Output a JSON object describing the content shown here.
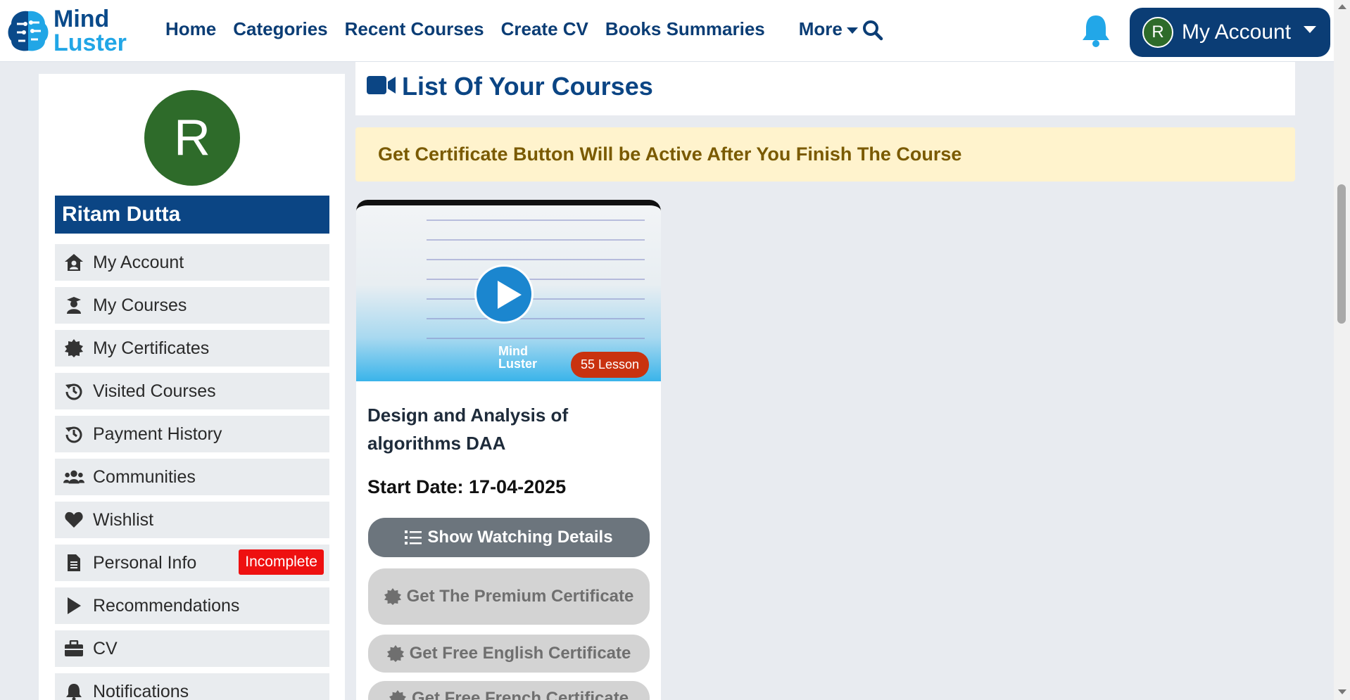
{
  "logo": {
    "line1": "Mind",
    "line2": "Luster"
  },
  "nav": {
    "items": [
      "Home",
      "Categories",
      "Recent Courses",
      "Create CV",
      "Books Summaries"
    ],
    "more": "More"
  },
  "account": {
    "avatar_letter": "R",
    "label": "My Account"
  },
  "sidebar": {
    "avatar_letter": "R",
    "user_name": "Ritam Dutta",
    "items": [
      {
        "label": "My Account",
        "icon": "home-user-icon"
      },
      {
        "label": "My Courses",
        "icon": "graduate-icon"
      },
      {
        "label": "My Certificates",
        "icon": "certificate-icon"
      },
      {
        "label": "Visited Courses",
        "icon": "history-icon"
      },
      {
        "label": "Payment History",
        "icon": "history-icon"
      },
      {
        "label": "Communities",
        "icon": "users-icon"
      },
      {
        "label": "Wishlist",
        "icon": "heart-icon"
      },
      {
        "label": "Personal Info",
        "icon": "file-icon",
        "badge": "Incomplete"
      },
      {
        "label": "Recommendations",
        "icon": "play-icon"
      },
      {
        "label": "CV",
        "icon": "briefcase-icon"
      },
      {
        "label": "Notifications",
        "icon": "bell-icon"
      }
    ]
  },
  "main": {
    "title": "List Of Your Courses",
    "alert": "Get Certificate Button Will be Active After You Finish The Course",
    "course": {
      "thumb_logo_line1": "Mind",
      "thumb_logo_line2": "Luster",
      "lessons": "55 Lesson",
      "name": "Design and Analysis of algorithms DAA",
      "start_date": "Start Date: 17-04-2025",
      "btn_watch": "Show Watching Details",
      "btn_premium": "Get The Premium Certificate",
      "btn_english": "Get Free English Certificate",
      "btn_french": "Get Free French Certificate"
    }
  },
  "colors": {
    "brand_dark": "#0b3d75",
    "brand_light": "#21a6e6",
    "alert_bg": "#fff3cd",
    "badge": "#ee1010"
  }
}
